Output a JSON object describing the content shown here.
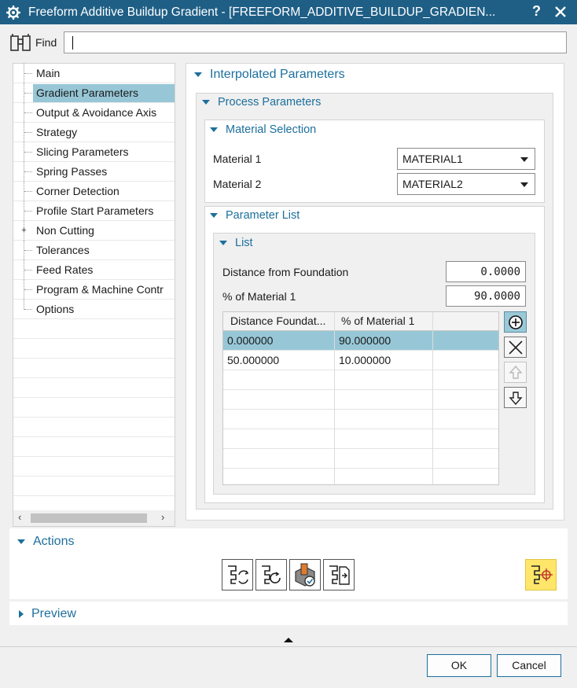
{
  "window": {
    "title": "Freeform Additive Buildup Gradient - [FREEFORM_ADDITIVE_BUILDUP_GRADIEN...",
    "help_label": "?",
    "title_icon": "gear-icon",
    "close_icon": "close-icon",
    "accent_color": "#1f5f86"
  },
  "find": {
    "label": "Find",
    "value": "",
    "icon": "binoculars-icon"
  },
  "nav": {
    "items": [
      {
        "label": "Main"
      },
      {
        "label": "Gradient Parameters",
        "selected": true
      },
      {
        "label": "Output & Avoidance Axis"
      },
      {
        "label": "Strategy"
      },
      {
        "label": "Slicing Parameters"
      },
      {
        "label": "Spring Passes"
      },
      {
        "label": "Corner Detection"
      },
      {
        "label": "Profile Start Parameters"
      },
      {
        "label": "Non Cutting",
        "expandable": true
      },
      {
        "label": "Tolerances"
      },
      {
        "label": "Feed Rates"
      },
      {
        "label": "Program & Machine Contr"
      },
      {
        "label": "Options"
      }
    ],
    "scroll_left": "‹",
    "scroll_right": "›"
  },
  "interpolated": {
    "title": "Interpolated Parameters",
    "process": {
      "title": "Process Parameters",
      "material_selection": {
        "title": "Material Selection",
        "material1_label": "Material 1",
        "material1_value": "MATERIAL1",
        "material2_label": "Material 2",
        "material2_value": "MATERIAL2"
      },
      "parameter_list": {
        "title": "Parameter List",
        "list": {
          "title": "List",
          "distance_label": "Distance from Foundation",
          "distance_value": "0.0000",
          "percent_label": "% of Material 1",
          "percent_value": "90.0000",
          "columns": [
            "Distance Foundat...",
            "% of Material 1",
            ""
          ],
          "rows": [
            [
              "0.000000",
              "90.000000",
              ""
            ],
            [
              "50.000000",
              "10.000000",
              ""
            ]
          ],
          "buttons": {
            "add": "add-circle-icon",
            "remove": "remove-x-icon",
            "move_up": "arrow-up-icon",
            "move_down": "arrow-down-icon"
          }
        }
      }
    }
  },
  "actions": {
    "title": "Actions",
    "buttons": [
      "generate-icon",
      "replay-icon",
      "verify-icon",
      "list-icon",
      "display-icon"
    ]
  },
  "preview": {
    "title": "Preview"
  },
  "dialog": {
    "ok_label": "OK",
    "cancel_label": "Cancel"
  }
}
